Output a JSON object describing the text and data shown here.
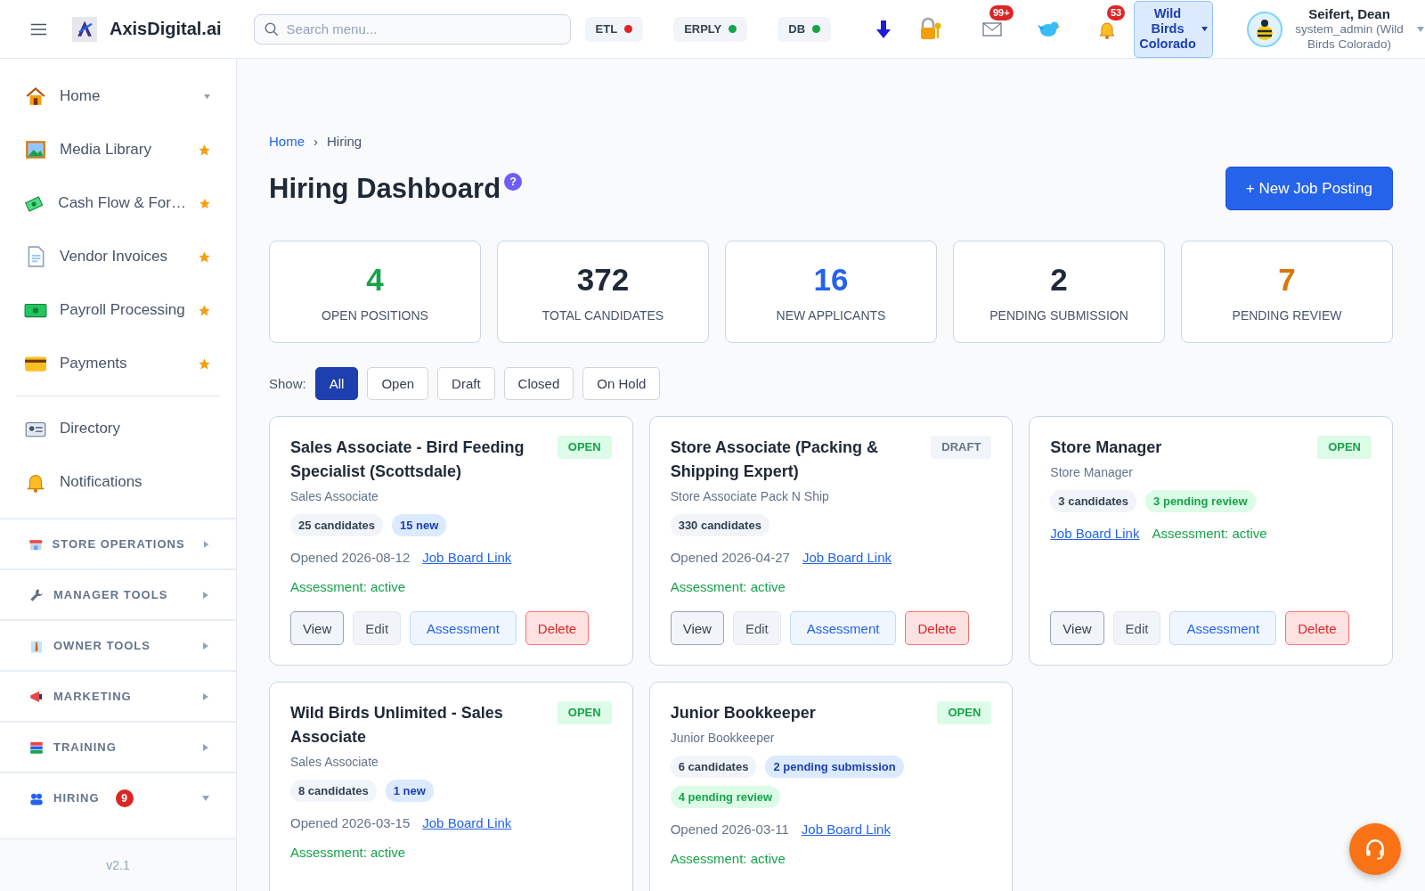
{
  "header": {
    "brand": "AxisDigital.ai",
    "search": {
      "placeholder": "Search menu..."
    },
    "services": [
      {
        "label": "ETL",
        "color": "#dc2626"
      },
      {
        "label": "ERPLY",
        "color": "#16a34a"
      },
      {
        "label": "DB",
        "color": "#16a34a"
      }
    ],
    "mail_badge": "99+",
    "bell_badge": "53",
    "org": {
      "label": "Wild Birds Colorado"
    },
    "user": {
      "name": "Seifert, Dean",
      "role": "system_admin (Wild Birds Colorado)"
    }
  },
  "sidebar": {
    "items": [
      {
        "label": "Home",
        "kind": "expandable",
        "selected": false
      },
      {
        "label": "Media Library",
        "kind": "favorite",
        "selected": false
      },
      {
        "label": "Cash Flow & For…",
        "kind": "favorite",
        "selected": false
      },
      {
        "label": "Vendor Invoices",
        "kind": "favorite",
        "selected": false
      },
      {
        "label": "Payroll Processing",
        "kind": "favorite",
        "selected": false
      },
      {
        "label": "Payments",
        "kind": "favorite",
        "selected": false
      },
      {
        "label": "Directory",
        "kind": "plain",
        "selected": false
      },
      {
        "label": "Notifications",
        "kind": "plain",
        "selected": false
      }
    ],
    "sections": [
      {
        "label": "STORE OPERATIONS",
        "expanded": false
      },
      {
        "label": "MANAGER TOOLS",
        "expanded": false
      },
      {
        "label": "OWNER TOOLS",
        "expanded": false
      },
      {
        "label": "MARKETING",
        "expanded": false
      },
      {
        "label": "TRAINING",
        "expanded": false
      },
      {
        "label": "HIRING",
        "expanded": true,
        "badge": "9"
      }
    ],
    "version": "v2.1"
  },
  "breadcrumb": [
    {
      "label": "Home",
      "kind": "link"
    },
    {
      "label": "Hiring",
      "kind": "current"
    }
  ],
  "breadcrumb_separator": "›",
  "title": "Hiring Dashboard",
  "help": "?",
  "new_button": "+ New Job Posting",
  "stats": [
    {
      "value": "4",
      "label": "OPEN POSITIONS",
      "color": "#16a34a"
    },
    {
      "value": "372",
      "label": "TOTAL CANDIDATES",
      "color": "#1f2937"
    },
    {
      "value": "16",
      "label": "NEW APPLICANTS",
      "color": "#2563eb"
    },
    {
      "value": "2",
      "label": "PENDING SUBMISSION",
      "color": "#1f2937"
    },
    {
      "value": "7",
      "label": "PENDING REVIEW",
      "color": "#d97706"
    }
  ],
  "filter": {
    "label": "Show:",
    "options": [
      {
        "label": "All",
        "selected": true
      },
      {
        "label": "Open",
        "selected": false
      },
      {
        "label": "Draft",
        "selected": false
      },
      {
        "label": "Closed",
        "selected": false
      },
      {
        "label": "On Hold",
        "selected": false
      }
    ]
  },
  "jobs": [
    {
      "title": "Sales Associate - Bird Feeding Specialist (Scottsdale)",
      "status": {
        "label": "OPEN",
        "kind": "open"
      },
      "subtitle": "Sales Associate",
      "chips": [
        {
          "label": "25 candidates",
          "kind": "neutral"
        },
        {
          "label": "15 new",
          "kind": "blue"
        }
      ],
      "opened": "Opened 2026-08-12",
      "link": "Job Board Link",
      "assessment": "Assessment: active",
      "buttons": [
        {
          "label": "View",
          "kind": "view"
        },
        {
          "label": "Edit",
          "kind": "edit"
        },
        {
          "label": "Assessment",
          "kind": "assessment"
        },
        {
          "label": "Delete",
          "kind": "delete"
        }
      ]
    },
    {
      "title": "Store Associate (Packing & Shipping Expert)",
      "status": {
        "label": "DRAFT",
        "kind": "draft"
      },
      "subtitle": "Store Associate Pack N Ship",
      "chips": [
        {
          "label": "330 candidates",
          "kind": "neutral"
        }
      ],
      "opened": "Opened 2026-04-27",
      "link": "Job Board Link",
      "assessment": "Assessment: active",
      "buttons": [
        {
          "label": "View",
          "kind": "view"
        },
        {
          "label": "Edit",
          "kind": "edit"
        },
        {
          "label": "Assessment",
          "kind": "assessment"
        },
        {
          "label": "Delete",
          "kind": "delete"
        }
      ]
    },
    {
      "title": "Store Manager",
      "status": {
        "label": "OPEN",
        "kind": "open"
      },
      "subtitle": "Store Manager",
      "chips": [
        {
          "label": "3 candidates",
          "kind": "neutral"
        },
        {
          "label": "3 pending review",
          "kind": "green"
        }
      ],
      "link": "Job Board Link",
      "assessment": "Assessment: active",
      "buttons": [
        {
          "label": "View",
          "kind": "view"
        },
        {
          "label": "Edit",
          "kind": "edit"
        },
        {
          "label": "Assessment",
          "kind": "assessment"
        },
        {
          "label": "Delete",
          "kind": "delete"
        }
      ]
    },
    {
      "title": "Wild Birds Unlimited - Sales Associate",
      "status": {
        "label": "OPEN",
        "kind": "open"
      },
      "subtitle": "Sales Associate",
      "chips": [
        {
          "label": "8 candidates",
          "kind": "neutral"
        },
        {
          "label": "1 new",
          "kind": "blue"
        }
      ],
      "opened": "Opened 2026-03-15",
      "link": "Job Board Link",
      "assessment": "Assessment: active"
    },
    {
      "title": "Junior Bookkeeper",
      "status": {
        "label": "OPEN",
        "kind": "open"
      },
      "subtitle": "Junior Bookkeeper",
      "chips": [
        {
          "label": "6 candidates",
          "kind": "neutral"
        },
        {
          "label": "2 pending submission",
          "kind": "blue"
        },
        {
          "label": "4 pending review",
          "kind": "green"
        }
      ],
      "opened": "Opened 2026-03-11",
      "link": "Job Board Link",
      "assessment": "Assessment: active"
    }
  ]
}
